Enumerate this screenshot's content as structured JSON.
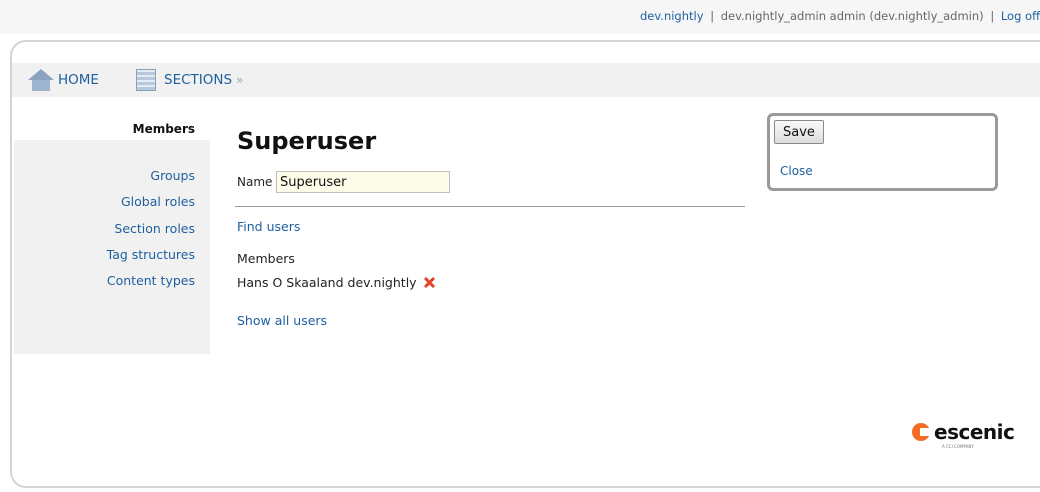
{
  "topbar": {
    "user_link": "dev.nightly",
    "separator": "|",
    "user_info": "dev.nightly_admin admin (dev.nightly_admin)",
    "logoff": "Log off"
  },
  "nav": {
    "home_label": "HOME",
    "sections_label": "SECTIONS",
    "sections_suffix": "»"
  },
  "sidebar": {
    "items": [
      {
        "label": "Members",
        "selected": true
      },
      {
        "label": "Groups"
      },
      {
        "label": "Global roles"
      },
      {
        "label": "Section roles"
      },
      {
        "label": "Tag structures"
      },
      {
        "label": "Content types"
      }
    ]
  },
  "main": {
    "title": "Superuser",
    "name_label": "Name",
    "name_value": "Superuser",
    "find_users": "Find users",
    "members_heading": "Members",
    "members": [
      {
        "name": "Hans O Skaaland dev.nightly"
      }
    ],
    "show_all_users": "Show all users"
  },
  "actions": {
    "save_label": "Save",
    "close_label": "Close"
  },
  "logo": {
    "text": "escenic",
    "subtext": "A CCI COMPANY"
  },
  "colors": {
    "link": "#1e5f9e",
    "remove_icon": "#e2452c",
    "logo_accent": "#f36c21",
    "panel_bg": "#f1f1f1"
  },
  "icons": {
    "home": "home-icon",
    "sections": "sections-icon",
    "remove": "remove-member-icon"
  }
}
